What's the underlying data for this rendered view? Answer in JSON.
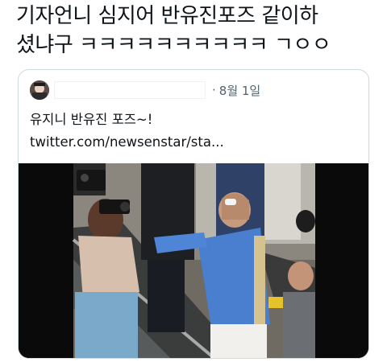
{
  "tweet": {
    "text": "기자언니 심지어 반유진포즈 같이하\n셨냐구 ㅋㅋㅋㅋㅋㅋㅋㅋㅋㅋ ㄱㅇㅇ"
  },
  "quote": {
    "separator": "·",
    "date": "8월 1일",
    "body_text": "유지니 반유진 포즈~!",
    "link_text": "twitter.com/newsenstar/sta..."
  },
  "media": {
    "type": "photo",
    "description_icon": "photo-icon"
  },
  "colors": {
    "text_primary": "#0f1419",
    "text_secondary": "#536471",
    "border": "#cfd9de",
    "shirt_blue": "#4a7fd0"
  }
}
